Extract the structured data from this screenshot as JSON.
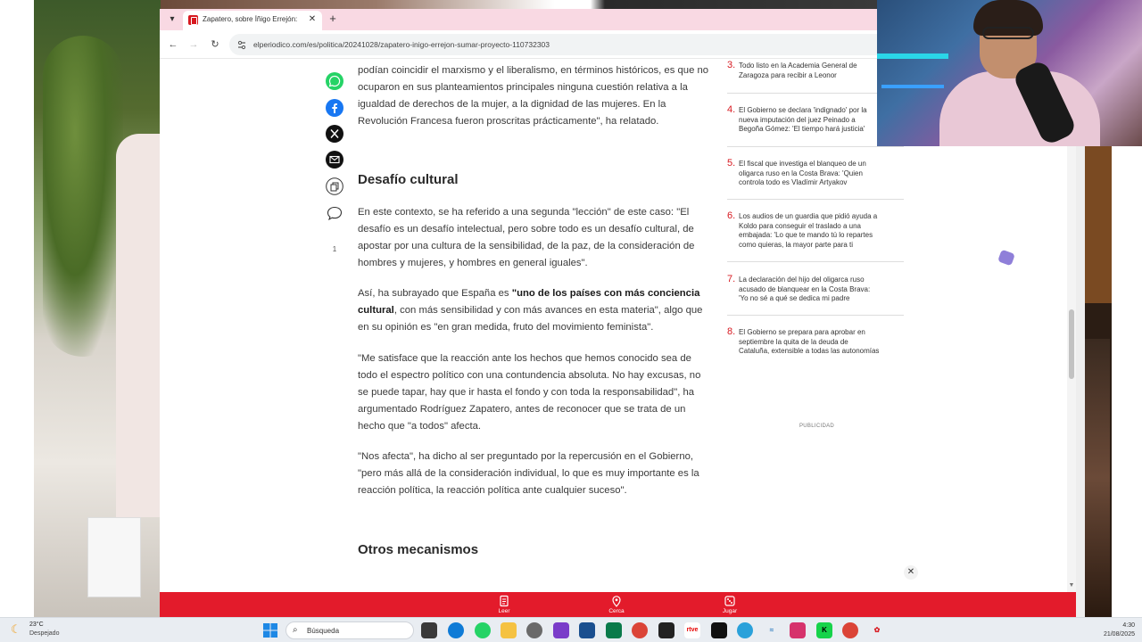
{
  "browser": {
    "tab_title": "Zapatero, sobre Íñigo Errejón:",
    "url": "elperiodico.com/es/politica/20241028/zapatero-inigo-errejon-sumar-proyecto-110732303",
    "tab_menu_icon": "chevron-down-icon",
    "new_tab_icon": "plus-icon"
  },
  "article": {
    "para1": "podían coincidir el marxismo y el liberalismo, en términos históricos, es que no ocuparon en sus planteamientos principales ninguna cuestión relativa a la igualdad de derechos de la mujer, a la dignidad de las mujeres. En la Revolución Francesa fueron proscritas prácticamente\", ha relatado.",
    "heading1": "Desafío cultural",
    "para2": "En este contexto, se ha referido a una segunda \"lección\" de este caso: \"El desafío es un desafío intelectual, pero sobre todo es un desafío cultural, de apostar por una cultura de la sensibilidad, de la paz, de la consideración de hombres y mujeres, y hombres en general iguales\".",
    "para3_pre": "Así, ha subrayado que España es ",
    "para3_bold": "\"uno de los países con más conciencia cultural",
    "para3_post": ", con más sensibilidad y con más avances en esta materia\", algo que en su opinión es \"en gran medida, fruto del movimiento feminista\".",
    "para4": "\"Me satisface que la reacción ante los hechos que hemos conocido sea de todo el espectro político con una contundencia absoluta. No hay excusas, no se puede tapar, hay que ir hasta el fondo y con toda la responsabilidad\", ha argumentado Rodríguez Zapatero, antes de reconocer que se trata de un hecho que \"a todos\" afecta.",
    "para5": "\"Nos afecta\", ha dicho al ser preguntado por la repercusión en el Gobierno, \"pero más allá de la consideración individual, lo que es muy importante es la reacción política, la reacción política ante cualquier suceso\".",
    "heading2": "Otros mecanismos"
  },
  "share": {
    "comment_count": "1",
    "colors": {
      "whatsapp": "#25d366",
      "facebook": "#1877f2",
      "x": "#111111",
      "email": "#111111"
    }
  },
  "most_read": [
    {
      "num": "3.",
      "text": "Todo listo en la Academia General de Zaragoza para recibir a Leonor"
    },
    {
      "num": "4.",
      "text": "El Gobierno se declara 'indignado' por la nueva imputación del juez Peinado a Begoña Gómez: 'El tiempo hará justicia'"
    },
    {
      "num": "5.",
      "text": "El fiscal que investiga el blanqueo de un oligarca ruso en la Costa Brava: 'Quien controla todo es Vladímir Artyakov"
    },
    {
      "num": "6.",
      "text": "Los audios de un guardia que pidió ayuda a Koldo para conseguir el traslado a una embajada: 'Lo que te mando tú lo repartes como quieras, la mayor parte para ti"
    },
    {
      "num": "7.",
      "text": "La declaración del hijo del oligarca ruso acusado de blanquear en la Costa Brava: 'Yo no sé a qué se dedica mi padre"
    },
    {
      "num": "8.",
      "text": "El Gobierno se prepara para aprobar en septiembre la quita de la deuda de Cataluña, extensible a todas las autonomías"
    }
  ],
  "ad_label": "PUBLICIDAD",
  "bottom_nav": {
    "read": "Leer",
    "near": "Cerca",
    "play": "Jugar",
    "color": "#e31b2b"
  },
  "taskbar": {
    "temperature": "23°C",
    "condition": "Despejado",
    "search_placeholder": "Búsqueda",
    "time": "4:30",
    "date": "21/08/2025"
  }
}
